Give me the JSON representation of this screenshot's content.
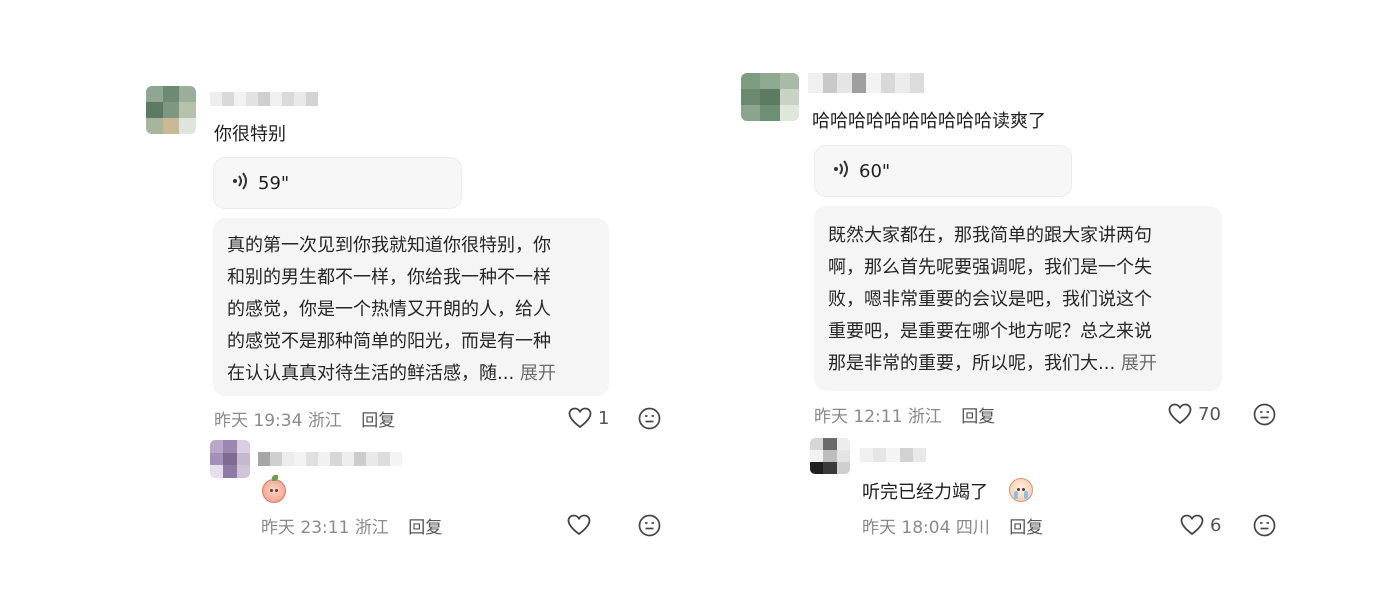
{
  "left": {
    "comment": {
      "text": "你很特别",
      "voice_duration": "59\"",
      "transcript_lines": [
        "真的第一次见到你我就知道你很特别，你",
        "和别的男生都不一样，你给我一种不一样",
        "的感觉，你是一个热情又开朗的人，给人",
        "的感觉不是那种简单的阳光，而是有一种",
        "在认认真真对待生活的鲜活感，随..."
      ],
      "expand_label": "展开",
      "time": "昨天 19:34",
      "location": "浙江",
      "reply_label": "回复",
      "likes": "1"
    },
    "reply": {
      "emoji": "peach-face-emoji",
      "time": "昨天 23:11",
      "location": "浙江",
      "reply_label": "回复",
      "likes": ""
    }
  },
  "right": {
    "comment": {
      "text": "哈哈哈哈哈哈哈哈哈哈读爽了",
      "voice_duration": "60\"",
      "transcript_lines": [
        "既然大家都在，那我简单的跟大家讲两句",
        "啊，那么首先呢要强调呢，我们是一个失",
        "败，嗯非常重要的会议是吧，我们说这个",
        "重要吧，是重要在哪个地方呢？总之来说",
        "那是非常的重要，所以呢，我们大..."
      ],
      "expand_label": "展开",
      "time": "昨天 12:11",
      "location": "浙江",
      "reply_label": "回复",
      "likes": "70"
    },
    "reply": {
      "text": "听完已经力竭了",
      "emoji": "crying-face-emoji",
      "time": "昨天 18:04",
      "location": "四川",
      "reply_label": "回复",
      "likes": "6"
    }
  },
  "icons": {
    "voice": "sound-wave-icon",
    "like": "heart-outline-icon",
    "dislike": "neutral-face-icon"
  }
}
